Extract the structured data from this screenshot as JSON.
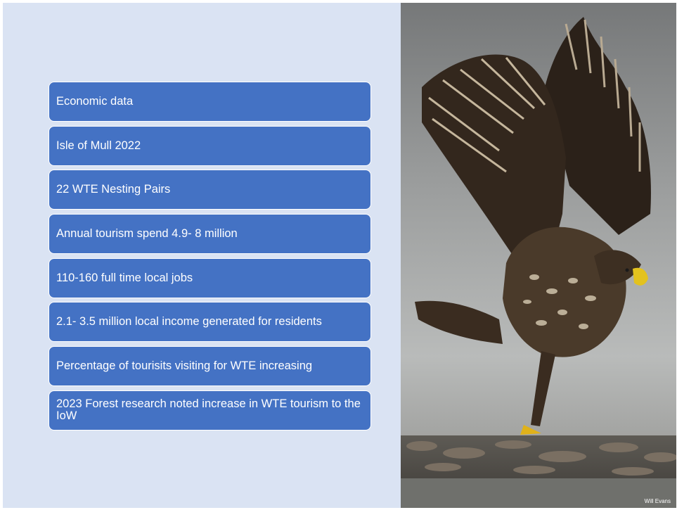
{
  "slide": {
    "items": [
      "Economic data",
      "Isle of Mull 2022",
      "22 WTE Nesting Pairs",
      "Annual tourism spend 4.9- 8 million",
      "110-160 full time local jobs",
      "2.1- 3.5 million local income generated for residents",
      "Percentage of tourisits visiting for WTE increasing",
      "2023 Forest research noted increase in WTE tourism to the IoW"
    ],
    "photo": {
      "subject": "eagle-photo",
      "credit": "Will Evans"
    }
  }
}
